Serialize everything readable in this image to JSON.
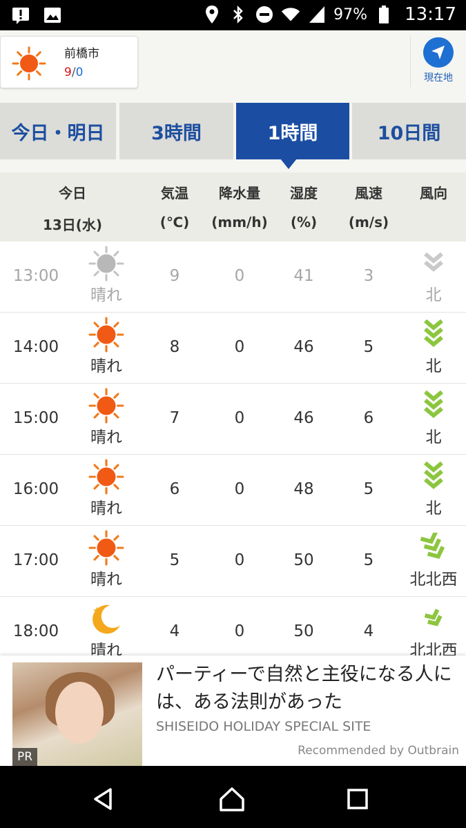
{
  "status_bar": {
    "battery": "97%",
    "time": "13:17",
    "icons": [
      "notification-alert-icon",
      "image-icon",
      "location-pin-icon",
      "bluetooth-icon",
      "do-not-disturb-icon",
      "wifi-icon",
      "signal-icon",
      "battery-icon"
    ]
  },
  "header": {
    "city": "前橋市",
    "temp_high": "9",
    "temp_sep": "/",
    "temp_low": "0",
    "current_location_label": "現在地"
  },
  "tabs": [
    {
      "label": "今日・明日",
      "active": false
    },
    {
      "label": "3時間",
      "active": false
    },
    {
      "label": "1時間",
      "active": true
    },
    {
      "label": "10日間",
      "active": false
    }
  ],
  "table_header": {
    "day": "今日",
    "date": "13日(水)",
    "temp": "気温",
    "temp_unit": "(℃)",
    "precip": "降水量",
    "precip_unit": "(mm/h)",
    "humidity": "湿度",
    "humidity_unit": "(%)",
    "wind_speed": "風速",
    "wind_speed_unit": "(m/s)",
    "wind_dir": "風向"
  },
  "rows": [
    {
      "time": "13:00",
      "weather": "晴れ",
      "icon": "sun-gray-icon",
      "temp": "9",
      "precip": "0",
      "humidity": "41",
      "wind_speed": "3",
      "wind_dir": "北",
      "past": true
    },
    {
      "time": "14:00",
      "weather": "晴れ",
      "icon": "sun-icon",
      "temp": "8",
      "precip": "0",
      "humidity": "46",
      "wind_speed": "5",
      "wind_dir": "北",
      "past": false
    },
    {
      "time": "15:00",
      "weather": "晴れ",
      "icon": "sun-icon",
      "temp": "7",
      "precip": "0",
      "humidity": "46",
      "wind_speed": "6",
      "wind_dir": "北",
      "past": false
    },
    {
      "time": "16:00",
      "weather": "晴れ",
      "icon": "sun-icon",
      "temp": "6",
      "precip": "0",
      "humidity": "48",
      "wind_speed": "5",
      "wind_dir": "北",
      "past": false
    },
    {
      "time": "17:00",
      "weather": "晴れ",
      "icon": "sun-icon",
      "temp": "5",
      "precip": "0",
      "humidity": "50",
      "wind_speed": "5",
      "wind_dir": "北北西",
      "past": false
    },
    {
      "time": "18:00",
      "weather": "晴れ",
      "icon": "moon-icon",
      "temp": "4",
      "precip": "0",
      "humidity": "50",
      "wind_speed": "4",
      "wind_dir": "北北西",
      "past": false
    }
  ],
  "ad": {
    "title": "パーティーで自然と主役になる人には、ある法則があった",
    "source": "SHISEIDO HOLIDAY SPECIAL SITE",
    "recommended": "Recommended by Outbrain",
    "badge": "PR"
  },
  "colors": {
    "accent": "#1b4ea3",
    "tab_inactive": "#dcdcd8",
    "temp_high": "#d0141a",
    "temp_low": "#1a6fd8",
    "wind_icon": "#8cc63f"
  }
}
